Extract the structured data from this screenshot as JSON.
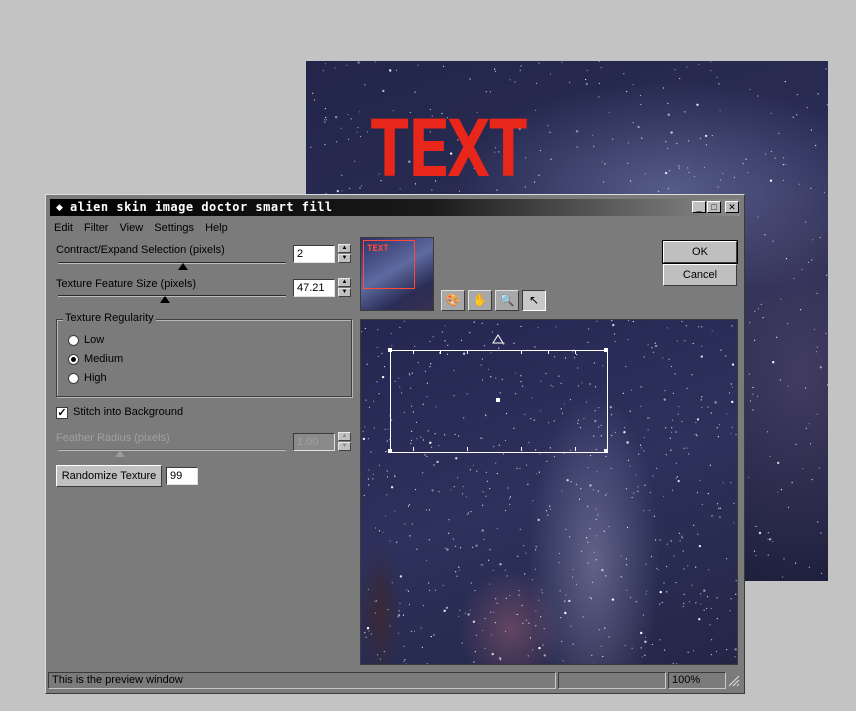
{
  "background_document": {
    "text": "TEXT"
  },
  "window": {
    "title": "alien skin image doctor smart fill",
    "buttons": {
      "minimize": "_",
      "maximize": "□",
      "close": "✕"
    }
  },
  "menu": [
    "Edit",
    "Filter",
    "View",
    "Settings",
    "Help"
  ],
  "controls": {
    "contract_expand": {
      "label": "Contract/Expand Selection (pixels)",
      "value": "2",
      "slider_fraction": 0.55
    },
    "texture_size": {
      "label": "Texture Feature Size (pixels)",
      "value": "47.21",
      "slider_fraction": 0.47
    },
    "texture_regularity": {
      "legend": "Texture Regularity",
      "options": [
        "Low",
        "Medium",
        "High"
      ],
      "selected": "Medium"
    },
    "stitch": {
      "label": "Stitch into Background",
      "checked": true
    },
    "feather_radius": {
      "label": "Feather Radius (pixels)",
      "value": "1.00",
      "disabled": true,
      "slider_fraction": 0.27
    },
    "randomize": {
      "label": "Randomize Texture",
      "value": "99"
    }
  },
  "dialog_buttons": {
    "ok": "OK",
    "cancel": "Cancel"
  },
  "thumbnail": {
    "text": "TEXT"
  },
  "tools": [
    "palette-tool-icon",
    "hand-icon",
    "zoom-icon",
    "arrow-pointer-icon"
  ],
  "status": {
    "message": "This is the preview window",
    "zoom": "100%"
  },
  "colors": {
    "dialog_bg": "#7b7b7b",
    "desktop_bg": "#c3c3c3",
    "text_red": "#e8261a"
  }
}
